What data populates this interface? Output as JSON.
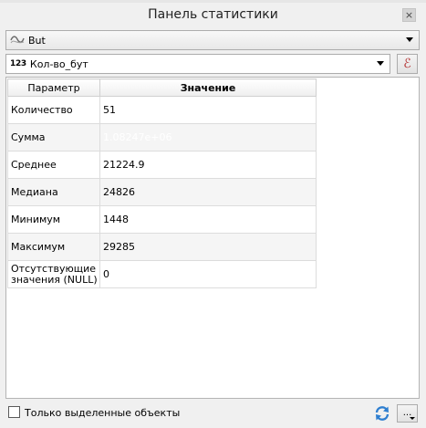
{
  "window": {
    "title": "Панель статистики",
    "close_label": "×"
  },
  "layer_combo": {
    "value": "But",
    "icon": "line-layer-icon"
  },
  "field_combo": {
    "value": "Кол-во_бут",
    "type_label": "123"
  },
  "expression_button": {
    "label": "ℰ"
  },
  "table": {
    "headers": [
      "Параметр",
      "Значение"
    ],
    "rows": [
      {
        "name": "Количество",
        "value": "51"
      },
      {
        "name": "Сумма",
        "value": "1.08247e+06"
      },
      {
        "name": "Среднее",
        "value": "21224.9"
      },
      {
        "name": "Медиана",
        "value": "24826"
      },
      {
        "name": "Минимум",
        "value": "1448"
      },
      {
        "name": "Максимум",
        "value": "29285"
      },
      {
        "name_line1": "Отсутствующие",
        "name_line2": "значения (NULL)",
        "value": "0"
      }
    ]
  },
  "bottom": {
    "selected_only_label": "Только выделенные объекты",
    "more_label": "..."
  },
  "colors": {
    "selection": "#3399ff",
    "expression_accent": "#b33030",
    "refresh_icon": "#2f7fd0"
  }
}
